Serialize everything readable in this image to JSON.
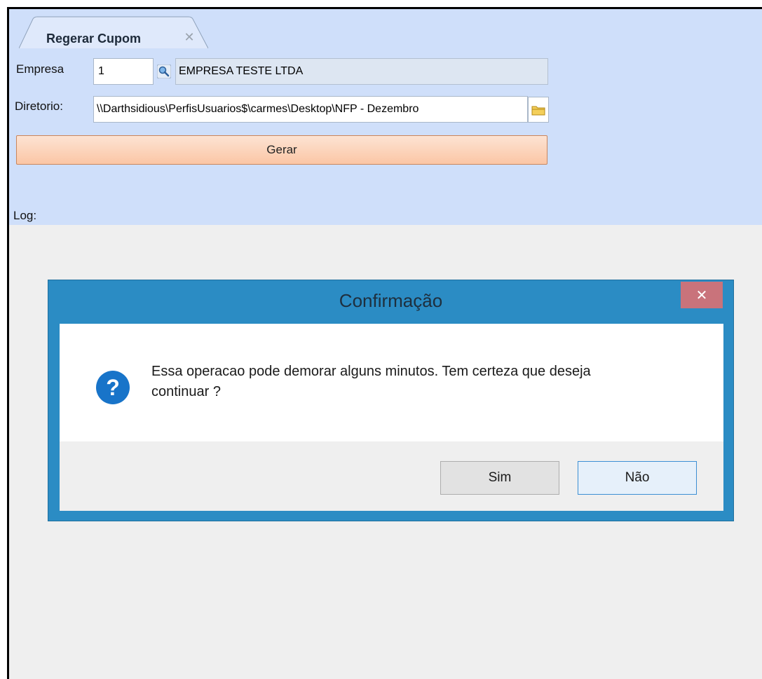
{
  "tab": {
    "title": "Regerar Cupom",
    "close_glyph": "✕"
  },
  "form": {
    "empresa_label": "Empresa",
    "empresa_code": "1",
    "empresa_name": "EMPRESA TESTE LTDA",
    "diretorio_label": "Diretorio:",
    "diretorio_value": "\\\\Darthsidious\\PerfisUsuarios$\\carmes\\Desktop\\NFP - Dezembro",
    "gerar_label": "Gerar",
    "log_label": "Log:"
  },
  "dialog": {
    "title": "Confirmação",
    "close_glyph": "✕",
    "message_line1": "Essa operacao pode demorar alguns minutos. Tem certeza que deseja",
    "message_line2": "continuar ?",
    "yes_label": "Sim",
    "no_label": "Não"
  },
  "icons": {
    "search": "search-icon",
    "folder": "folder-icon",
    "question": "question-icon",
    "close": "close-icon"
  },
  "colors": {
    "panel_bg": "#cfdffa",
    "button_accent": "#fbc6a5",
    "dialog_border": "#2b8cc4",
    "question_icon": "#1874c9",
    "dialog_close": "#c9737b"
  }
}
